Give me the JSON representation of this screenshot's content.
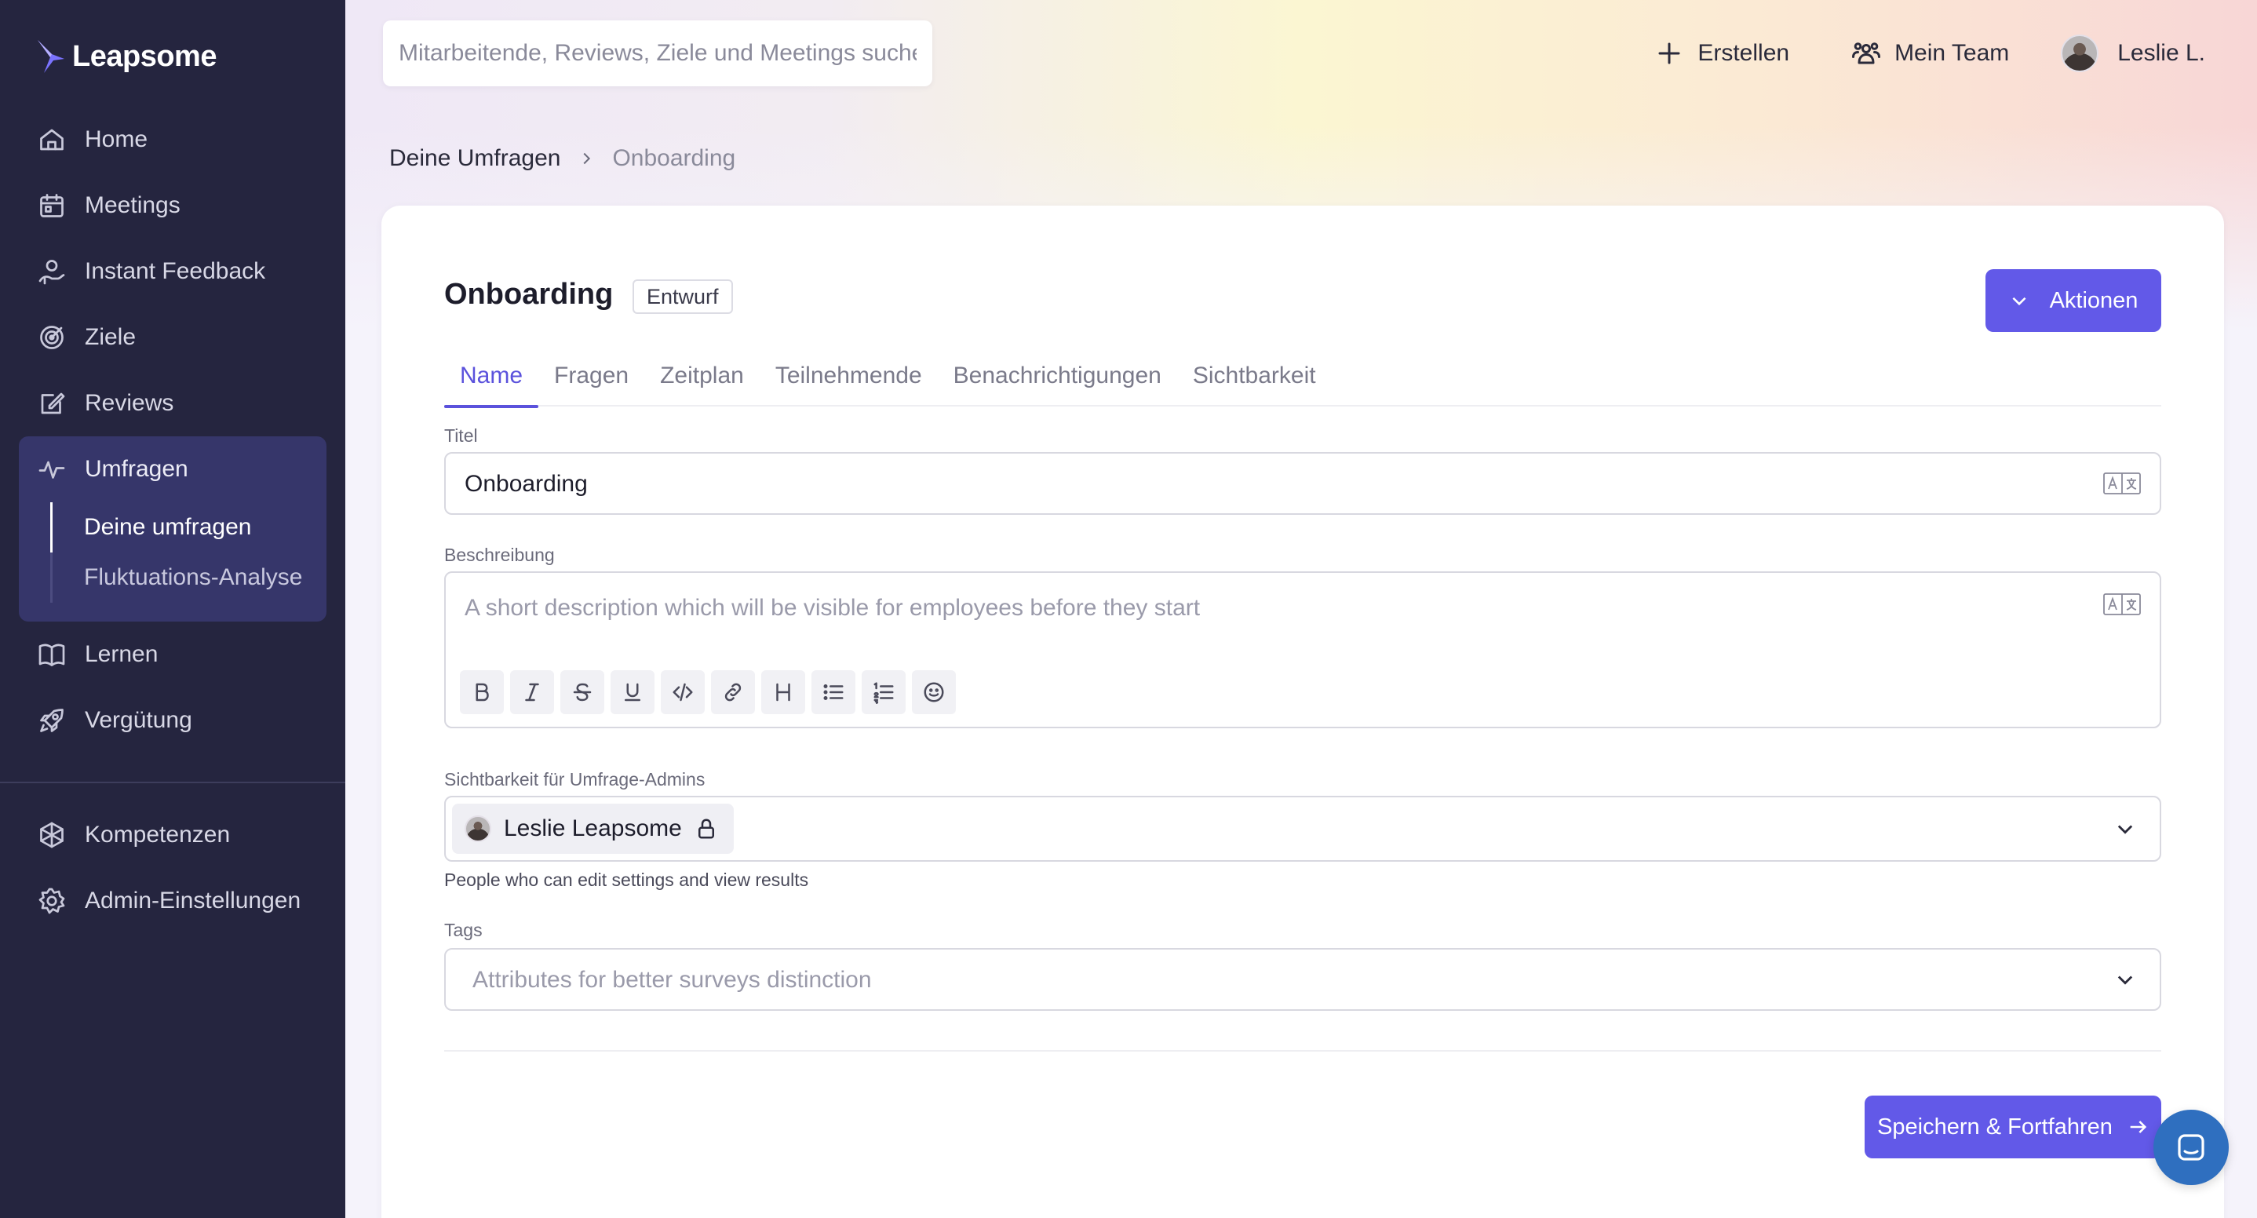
{
  "brand": {
    "name": "Leapsome"
  },
  "sidebar": {
    "items": [
      {
        "label": "Home",
        "icon": "home-icon"
      },
      {
        "label": "Meetings",
        "icon": "calendar-icon"
      },
      {
        "label": "Instant Feedback",
        "icon": "feedback-hand-icon"
      },
      {
        "label": "Ziele",
        "icon": "target-icon"
      },
      {
        "label": "Reviews",
        "icon": "edit-icon"
      }
    ],
    "group": {
      "label": "Umfragen",
      "icon": "pulse-icon",
      "sub": [
        {
          "label": "Deine umfragen",
          "active": true
        },
        {
          "label": "Fluktuations-Analyse",
          "active": false
        }
      ]
    },
    "items_after": [
      {
        "label": "Lernen",
        "icon": "book-icon"
      },
      {
        "label": "Vergütung",
        "icon": "rocket-icon"
      }
    ],
    "bottom": [
      {
        "label": "Kompetenzen",
        "icon": "competencies-icon"
      },
      {
        "label": "Admin-Einstellungen",
        "icon": "gear-icon"
      }
    ]
  },
  "header": {
    "search_placeholder": "Mitarbeitende, Reviews, Ziele und Meetings suchen",
    "create_label": "Erstellen",
    "team_label": "Mein Team",
    "user_label": "Leslie L."
  },
  "breadcrumb": {
    "parent": "Deine Umfragen",
    "current": "Onboarding"
  },
  "survey": {
    "title": "Onboarding",
    "status": "Entwurf",
    "actions_label": "Aktionen",
    "tabs": [
      {
        "label": "Name",
        "active": true
      },
      {
        "label": "Fragen",
        "active": false
      },
      {
        "label": "Zeitplan",
        "active": false
      },
      {
        "label": "Teilnehmende",
        "active": false
      },
      {
        "label": "Benachrichtigungen",
        "active": false
      },
      {
        "label": "Sichtbarkeit",
        "active": false
      }
    ]
  },
  "form": {
    "title_label": "Titel",
    "title_value": "Onboarding",
    "description_label": "Beschreibung",
    "description_placeholder": "A short description which will be visible for employees before they start",
    "toolbar": [
      "bold-icon",
      "italic-icon",
      "strikethrough-icon",
      "underline-icon",
      "code-icon",
      "link-icon",
      "heading-icon",
      "bullet-list-icon",
      "numbered-list-icon",
      "emoji-icon"
    ],
    "visibility_label": "Sichtbarkeit für Umfrage-Admins",
    "visibility_user": "Leslie Leapsome",
    "visibility_helper": "People who can edit settings and view results",
    "tags_label": "Tags",
    "tags_placeholder": "Attributes for better surveys distinction",
    "save_label": "Speichern & Fortfahren"
  },
  "colors": {
    "accent": "#6259e8",
    "sidebar": "#25253f",
    "chat": "#2f6fbf"
  }
}
